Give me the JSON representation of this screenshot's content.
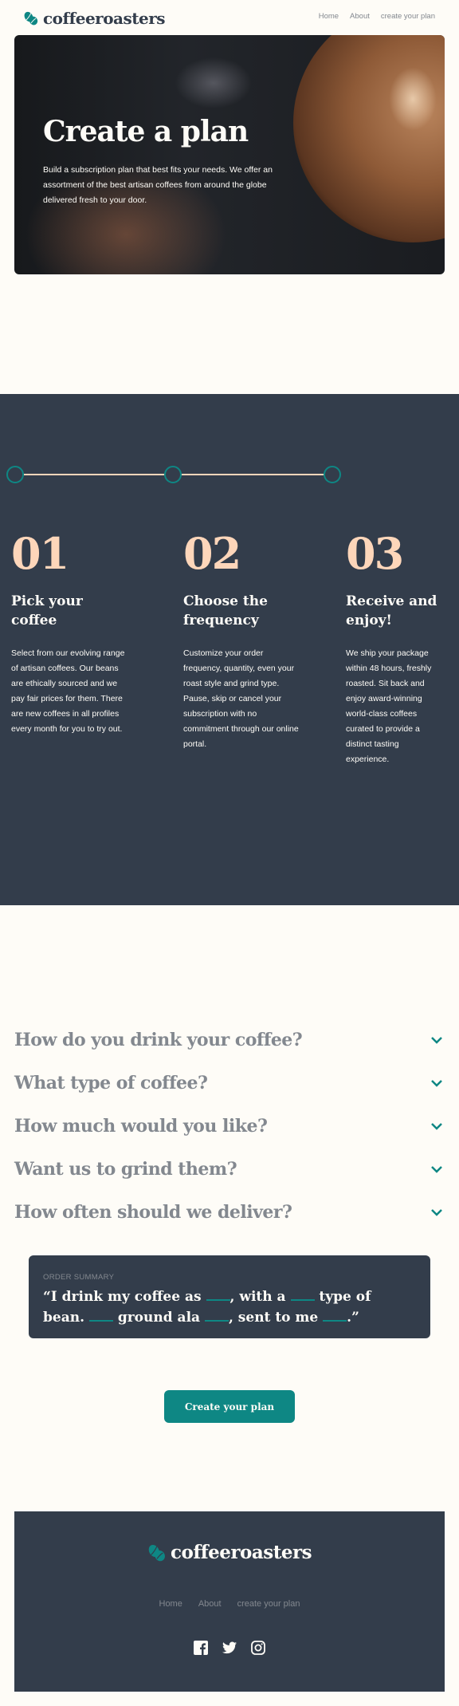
{
  "header": {
    "brand": "coffeeroasters",
    "nav": [
      "Home",
      "About",
      "create your plan"
    ]
  },
  "hero": {
    "title": "Create a plan",
    "text": "Build a subscription plan that best fits your needs. We offer an assortment of the best artisan coffees from around the globe delivered fresh to your door."
  },
  "steps": [
    {
      "number": "01",
      "title": "Pick your coffee",
      "text": "Select from our evolving range of artisan coffees. Our beans are ethically sourced and we pay fair prices for them. There are new coffees in all profiles every month for you to try out."
    },
    {
      "number": "02",
      "title": "Choose the frequency",
      "text": "Customize your order frequency, quantity, even your roast style and grind type. Pause, skip or cancel your subscription with no commitment through our online portal."
    },
    {
      "number": "03",
      "title": "Receive and enjoy!",
      "text": "We ship your package within 48 hours, freshly roasted. Sit back and enjoy award-winning world-class coffees curated to provide a distinct tasting experience."
    }
  ],
  "questions": [
    "How do you drink your coffee?",
    "What type of coffee?",
    "How much would you like?",
    "Want us to grind them?",
    "How often should we deliver?"
  ],
  "summary": {
    "label": "ORDER SUMMARY",
    "part1": "“I drink my coffee as",
    "part2": ", with a",
    "part3": "type of bean.",
    "part4": "ground ala",
    "part5": ", sent to me",
    "part6": ".”"
  },
  "cta": {
    "label": "Create your plan"
  },
  "footer": {
    "brand": "coffeeroasters",
    "nav": [
      "Home",
      "About",
      "create your plan"
    ],
    "social_icons": [
      "facebook-icon",
      "twitter-icon",
      "instagram-icon"
    ]
  },
  "colors": {
    "accent": "#0e8784",
    "dark": "#333d4b",
    "peach": "#fdd6ba",
    "grey": "#83888f",
    "background": "#fefcf7"
  }
}
